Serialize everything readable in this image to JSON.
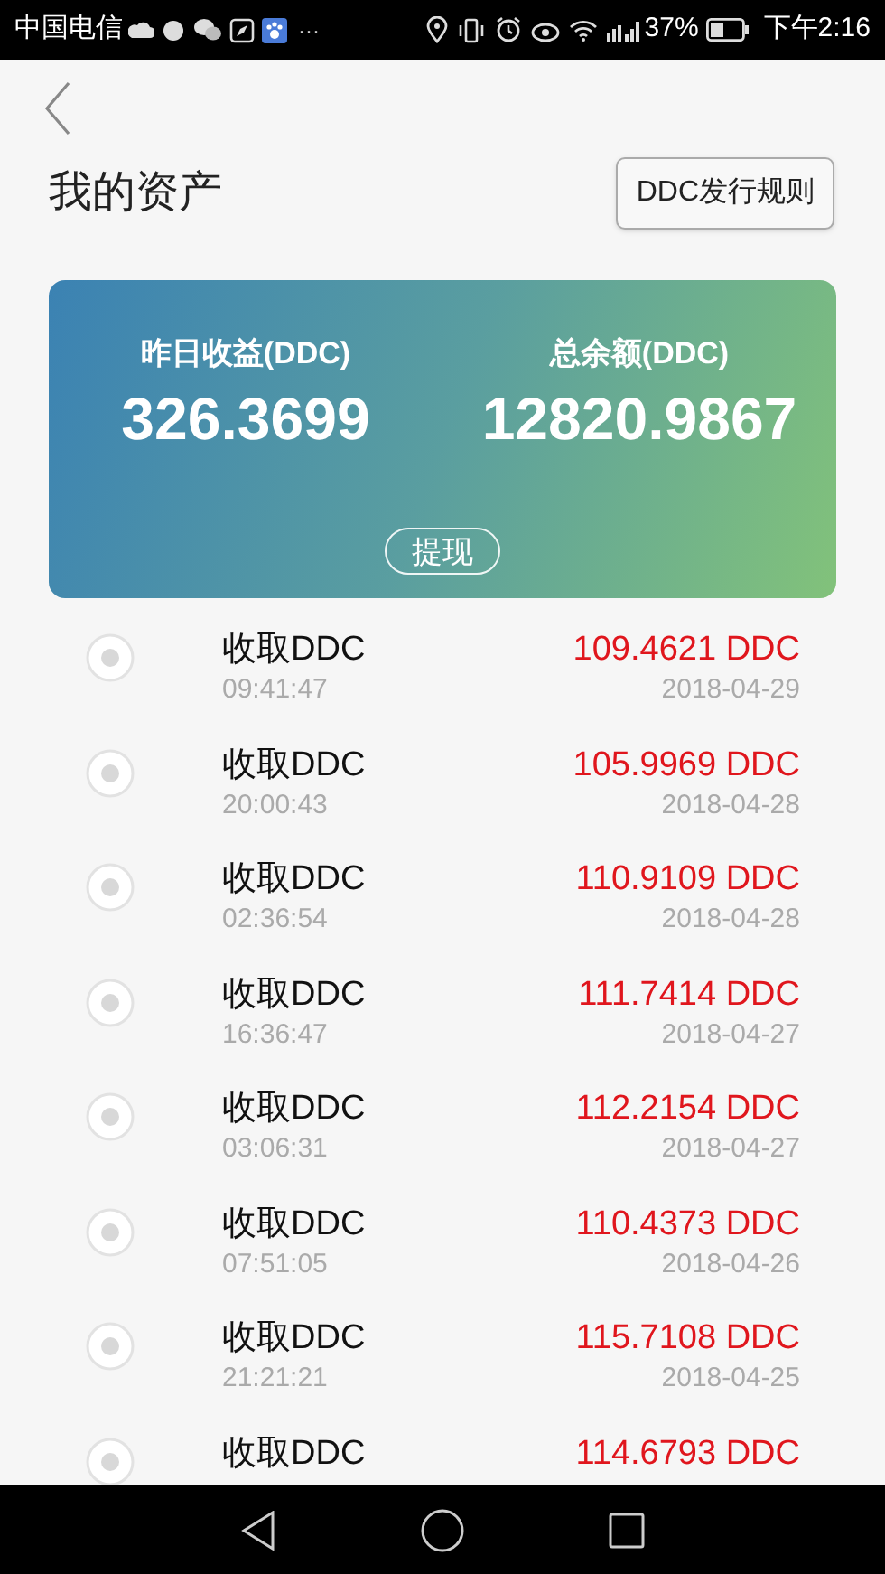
{
  "status_bar": {
    "carrier": "中国电信",
    "more": "···",
    "battery_text": "37%",
    "time": "下午2:16"
  },
  "header": {
    "title": "我的资产",
    "rules_button": "DDC发行规则"
  },
  "summary": {
    "stats": [
      {
        "label": "昨日收益(DDC)",
        "value": "326.3699"
      },
      {
        "label": "总余额(DDC)",
        "value": "12820.9867"
      }
    ],
    "withdraw_button": "提现"
  },
  "records": [
    {
      "title": "收取DDC",
      "time": "09:41:47",
      "amount": "109.4621 DDC",
      "date": "2018-04-29"
    },
    {
      "title": "收取DDC",
      "time": "20:00:43",
      "amount": "105.9969 DDC",
      "date": "2018-04-28"
    },
    {
      "title": "收取DDC",
      "time": "02:36:54",
      "amount": "110.9109 DDC",
      "date": "2018-04-28"
    },
    {
      "title": "收取DDC",
      "time": "16:36:47",
      "amount": "111.7414 DDC",
      "date": "2018-04-27"
    },
    {
      "title": "收取DDC",
      "time": "03:06:31",
      "amount": "112.2154 DDC",
      "date": "2018-04-27"
    },
    {
      "title": "收取DDC",
      "time": "07:51:05",
      "amount": "110.4373 DDC",
      "date": "2018-04-26"
    },
    {
      "title": "收取DDC",
      "time": "21:21:21",
      "amount": "115.7108 DDC",
      "date": "2018-04-25"
    },
    {
      "title": "收取DDC",
      "amount": "114.6793 DDC"
    }
  ]
}
